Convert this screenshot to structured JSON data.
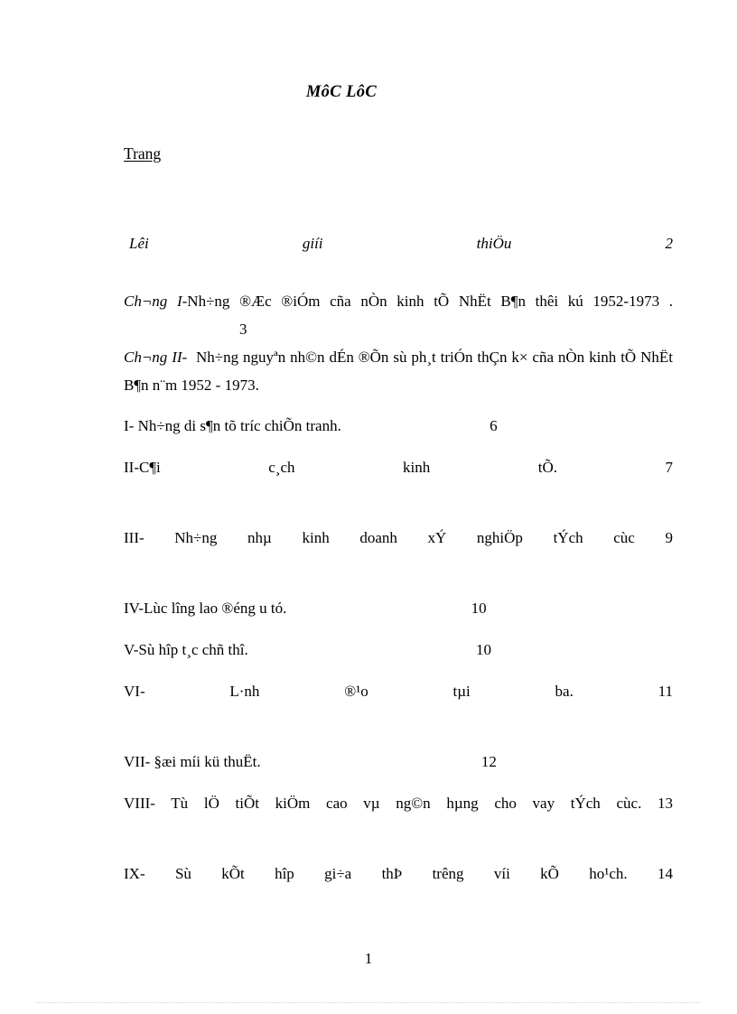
{
  "document": {
    "title": "MôC LôC",
    "section_heading": "Trang",
    "folio": "1"
  },
  "toc": {
    "entries": [
      {
        "id": "intro",
        "text": "Lêi giíi thiÖu",
        "page": "2",
        "style": "italic"
      },
      {
        "id": "chapter-1",
        "label": "Ch¬ng  I",
        "text": "-Nh÷ng ®Æc ®iÓm  cña nÒn kinh tÕ NhËt B¶n thêi kú 1952-1973 .",
        "page": "3",
        "style": "mixed"
      },
      {
        "id": "chapter-2",
        "label": "Ch¬ng  II-",
        "text": "Nh÷ng nguyªn nh©n dÉn ®Õn sù ph¸t triÓn thÇn k× cña nÒn kinh tÕ NhËt B¶n n¨m 1952 - 1973.",
        "page": "",
        "style": "mixed"
      },
      {
        "id": "item-1",
        "text": "I- Nh÷ng di s¶n tõ tríc  chiÕn tranh.",
        "page": "6",
        "style": "normal"
      },
      {
        "id": "item-2",
        "text": "II-C¶i c¸ch kinh tÕ.",
        "page": "7",
        "style": "justified"
      },
      {
        "id": "item-3",
        "text": "III- Nh÷ng nhµ kinh doanh xÝ nghiÖp tÝch cùc",
        "page": "9",
        "style": "justified"
      },
      {
        "id": "item-4",
        "text": "IV-Lùc lîng  lao ®éng u  tó.",
        "page": "10",
        "style": "normal"
      },
      {
        "id": "item-5",
        "text": "V-Sù hîp t¸c chñ thî.",
        "page": "10",
        "style": "normal"
      },
      {
        "id": "item-6",
        "text": "VI- L·nh ®¹o tµi ba.",
        "page": "11",
        "style": "justified"
      },
      {
        "id": "item-7",
        "text": "VII- §æi míi kü thuËt.",
        "page": "12",
        "style": "normal"
      },
      {
        "id": "item-8",
        "text": "VIII- Tù lÖ tiÕt kiÖm cao vµ ng©n hµng cho vay tÝch cùc.",
        "page": "13",
        "style": "justified"
      },
      {
        "id": "item-9",
        "text": "IX- Sù kÕt hîp gi÷a thÞ trêng víi kÕ ho¹ch.",
        "page": "14",
        "style": "justified"
      }
    ]
  }
}
